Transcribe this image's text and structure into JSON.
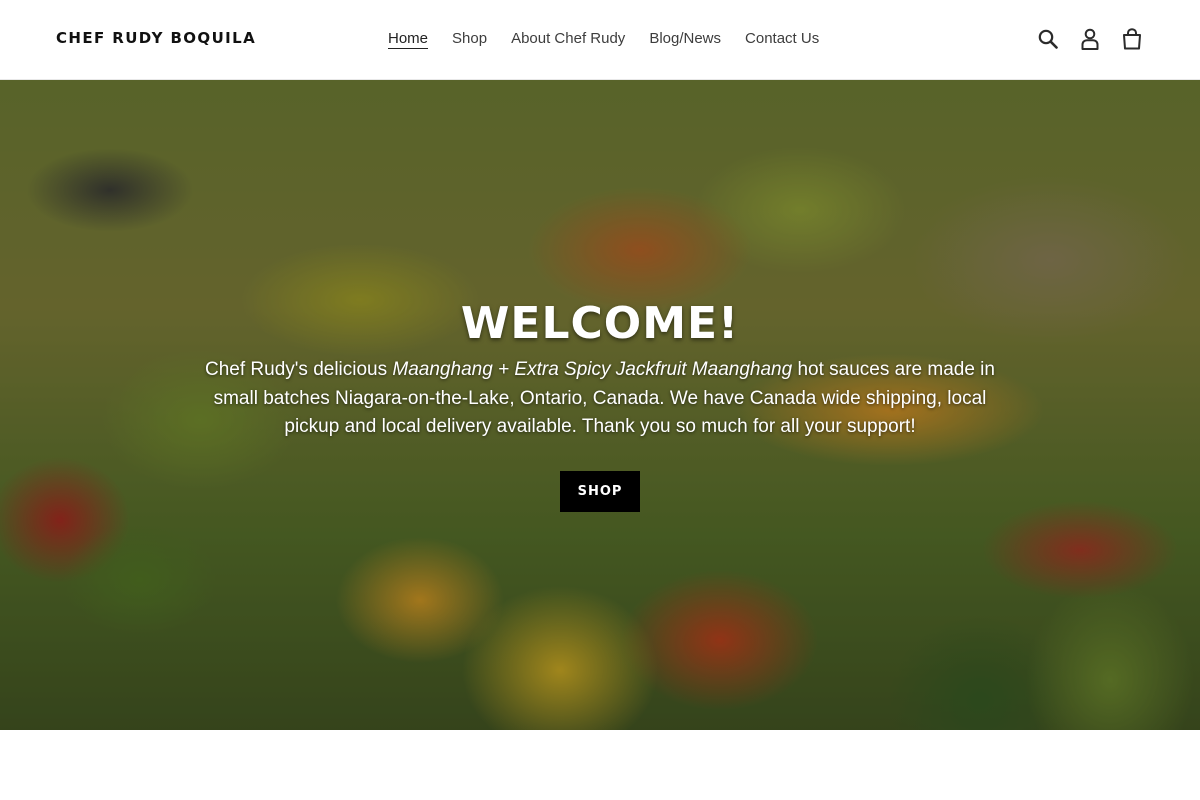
{
  "header": {
    "logo": "CHEF RUDY BOQUILA",
    "nav": [
      {
        "label": "Home",
        "active": true
      },
      {
        "label": "Shop"
      },
      {
        "label": "About Chef Rudy"
      },
      {
        "label": "Blog/News"
      },
      {
        "label": "Contact Us"
      }
    ],
    "icons": [
      "search-icon",
      "account-icon",
      "cart-icon"
    ]
  },
  "hero": {
    "title": "WELCOME!",
    "text_before": "Chef Rudy's delicious ",
    "text_italic": "Maanghang + Extra Spicy Jackfruit Maanghang",
    "text_after": " hot sauces are made in small batches Niagara-on-the-Lake, Ontario, Canada. We have Canada wide shipping, local pickup and local delivery available. Thank you so much for all your support!",
    "button_label": "SHOP"
  },
  "colors": {
    "button_bg": "#000000",
    "text_light": "#ffffff",
    "nav_text": "#3d3d3d"
  }
}
